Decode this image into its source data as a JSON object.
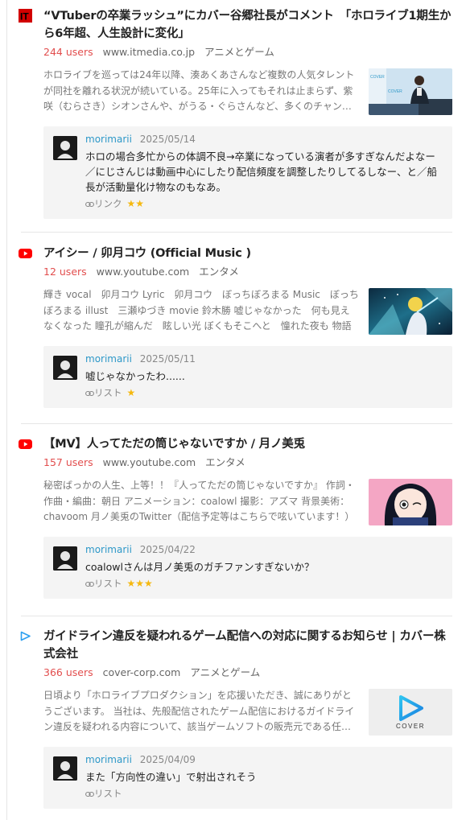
{
  "entries": [
    {
      "favicon": "itmedia-favicon",
      "title": "“VTuberの卒業ラッシュ”にカバー谷郷社長がコメント　「ホロライブ1期生から6年超、人生設計に変化」",
      "users": "244 users",
      "domain": "www.itmedia.co.jp",
      "category": "アニメとゲーム",
      "description": "ホロライブを巡っては24年以降、湊あくあさんなど複数の人気タレントが同社を離れる状況が続いている。25年に入ってもそれは止まらず、紫咲（むらさき）シオンさんや、がうる・ぐらさんなど、多くのチャン…",
      "comment": {
        "user": "morimarii",
        "date": "2025/05/14",
        "text": "ホロの場合多忙からの体調不良→卒業になっている演者が多すぎなんだよなー／にじさんじは動画中心にしたり配信頻度を調整したりしてるしなー、と／船長が活動量化け物なのもなあ。",
        "tag": "リンク",
        "stars": "★★"
      }
    },
    {
      "favicon": "youtube-favicon",
      "title": "アイシー / 卯月コウ (Official Music )",
      "users": "12 users",
      "domain": "www.youtube.com",
      "category": "エンタメ",
      "description": "輝き vocal　卯月コウ Lyric　卯月コウ　ぼっちぼろまる Music　ぼっちぼろまる illust　三瀬ゆづき movie 鈴木勝 嘘じゃなかった　何も見えなくなった 瞳孔が縮んだ　眩しい光 ぼくもそこへと　憧れた夜も 物語はま…",
      "comment": {
        "user": "morimarii",
        "date": "2025/05/11",
        "text": "嘘じゃなかったわ......",
        "tag": "リスト",
        "stars": "★"
      }
    },
    {
      "favicon": "youtube-favicon",
      "title": "【MV】人ってただの筒じゃないですか / 月ノ美兎",
      "users": "157 users",
      "domain": "www.youtube.com",
      "category": "エンタメ",
      "description": "秘密ばっかの人生、上等！！『人ってただの筒じゃないですか』 作詞・作曲・編曲：朝日 アニメーション：coalowl 撮影：アズマ 背景美術：chavoom 月ノ美兎のTwitter（配信予定等はこちらで呟いています！） http…",
      "comment": {
        "user": "morimarii",
        "date": "2025/04/22",
        "text": "coalowlさんは月ノ美兎のガチファンすぎないか？",
        "tag": "リスト",
        "stars": "★★★"
      }
    },
    {
      "favicon": "cover-favicon",
      "title": "ガイドライン違反を疑われるゲーム配信への対応に関するお知らせ | カバー株式会社",
      "users": "366 users",
      "domain": "cover-corp.com",
      "category": "アニメとゲーム",
      "description": "日頃より「ホロライブプロダクション」を応援いただき、誠にありがとうございます。 当社は、先般配信されたゲーム配信におけるガイドライン違反を疑われる内容について、該当ゲームソフトの販売元である任…",
      "thumb_text": "COVER",
      "comment": {
        "user": "morimarii",
        "date": "2025/04/09",
        "text": "また「方向性の違い」で射出されそう",
        "tag": "リスト",
        "stars": ""
      }
    }
  ],
  "colors": {
    "users": "#e24e4e",
    "comment_user": "#2d98c8",
    "star": "#f5b80f"
  }
}
